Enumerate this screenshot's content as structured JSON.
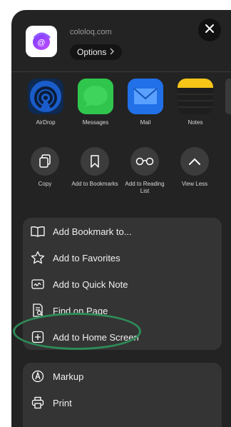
{
  "header": {
    "domain": "cololoq.com",
    "options_label": "Options"
  },
  "apps": [
    {
      "label": "AirDrop",
      "icon": "airdrop-icon"
    },
    {
      "label": "Messages",
      "icon": "messages-icon"
    },
    {
      "label": "Mail",
      "icon": "mail-icon"
    },
    {
      "label": "Notes",
      "icon": "notes-icon"
    }
  ],
  "actions": [
    {
      "label": "Copy",
      "icon": "copy-icon"
    },
    {
      "label": "Add to Bookmarks",
      "icon": "bookmark-icon"
    },
    {
      "label": "Add to Reading List",
      "icon": "glasses-icon"
    },
    {
      "label": "View Less",
      "icon": "chevron-up-icon"
    }
  ],
  "menu_group_1": [
    {
      "label": "Add Bookmark to...",
      "icon": "book-icon"
    },
    {
      "label": "Add to Favorites",
      "icon": "star-icon"
    },
    {
      "label": "Add to Quick Note",
      "icon": "quick-note-icon"
    },
    {
      "label": "Find on Page",
      "icon": "find-icon"
    },
    {
      "label": "Add to Home Screen",
      "icon": "plus-square-icon"
    }
  ],
  "menu_group_2": [
    {
      "label": "Markup",
      "icon": "markup-icon"
    },
    {
      "label": "Print",
      "icon": "print-icon"
    }
  ],
  "colors": {
    "sheet_bg": "#232323",
    "menu_bg": "#343434",
    "highlight": "#2e8b57"
  }
}
